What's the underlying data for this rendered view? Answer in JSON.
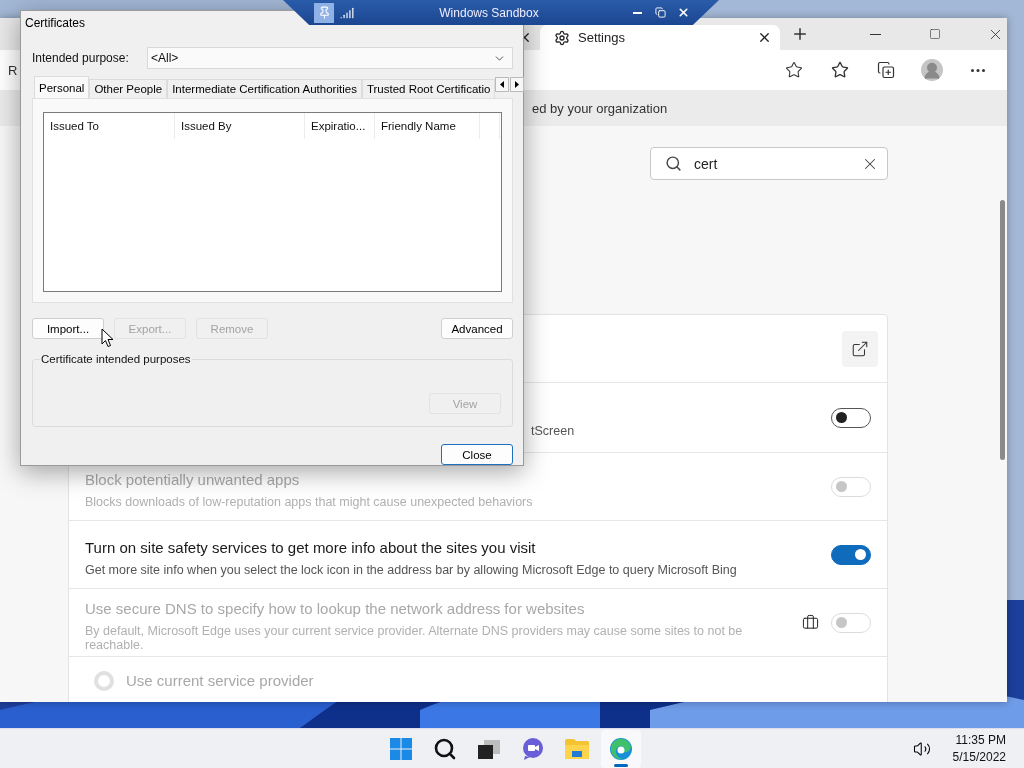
{
  "sandbox_bar": {
    "title": "Windows Sandbox"
  },
  "browser": {
    "tabs": [
      {
        "selected": false
      },
      {
        "label": "Settings",
        "selected": true
      }
    ],
    "toolbar_text": "R",
    "info_bar": "ed by your organization",
    "search": {
      "value": "cert"
    },
    "settings_rows": [
      {
        "kind": "link"
      },
      {
        "kind": "toggle",
        "description": "tScreen",
        "partial": true,
        "on": false,
        "disabled": false,
        "managed": false
      },
      {
        "kind": "toggle",
        "title": "Block potentially unwanted apps",
        "description": "Blocks downloads of low-reputation apps that might cause unexpected behaviors",
        "partial": false,
        "on": false,
        "disabled": true,
        "managed": false
      },
      {
        "kind": "toggle",
        "title": "Turn on site safety services to get more info about the sites you visit",
        "description": "Get more site info when you select the lock icon in the address bar by allowing Microsoft Edge to query Microsoft Bing",
        "partial": false,
        "on": true,
        "disabled": false,
        "managed": false
      },
      {
        "kind": "toggle",
        "title": "Use secure DNS to specify how to lookup the network address for websites",
        "description": "By default, Microsoft Edge uses your current service provider. Alternate DNS providers may cause some sites to not be reachable.",
        "partial": false,
        "on": false,
        "disabled": true,
        "managed": true
      },
      {
        "kind": "radio",
        "title": "Use current service provider",
        "selected": false,
        "disabled": true
      }
    ]
  },
  "dialog": {
    "title": "Certificates",
    "purpose_label": "Intended purpose:",
    "purpose_value": "<All>",
    "tabs": [
      {
        "label": "Personal",
        "selected": true
      },
      {
        "label": "Other People",
        "selected": false
      },
      {
        "label": "Intermediate Certification Authorities",
        "selected": false
      },
      {
        "label": "Trusted Root Certificatio",
        "selected": false
      }
    ],
    "columns": [
      "Issued To",
      "Issued By",
      "Expiratio...",
      "Friendly Name"
    ],
    "buttons": [
      {
        "label": "Import...",
        "disabled": false
      },
      {
        "label": "Export...",
        "disabled": true
      },
      {
        "label": "Remove",
        "disabled": true
      },
      {
        "label": "Advanced",
        "disabled": false
      }
    ],
    "group_title": "Certificate intended purposes",
    "view_button": {
      "label": "View",
      "disabled": true
    },
    "close_button": {
      "label": "Close",
      "default": true
    }
  },
  "taskbar": {
    "apps": [
      {
        "kind": "start",
        "active": false
      },
      {
        "kind": "search",
        "active": false
      },
      {
        "kind": "task_view",
        "active": false
      },
      {
        "kind": "chat",
        "active": false
      },
      {
        "kind": "explorer",
        "active": false
      },
      {
        "kind": "edge",
        "active": true
      }
    ],
    "time": "11:35 PM",
    "date": "5/15/2022"
  }
}
